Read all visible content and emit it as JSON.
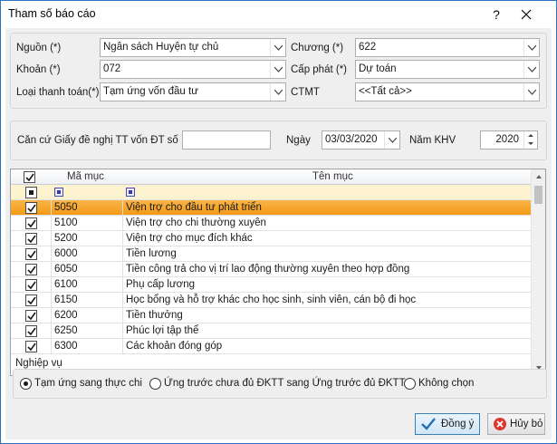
{
  "window": {
    "title": "Tham số báo cáo",
    "help_label": "?"
  },
  "params": {
    "nguon_label": "Nguồn (*)",
    "nguon_value": "Ngân sách Huyện tự chủ",
    "khoan_label": "Khoản (*)",
    "khoan_value": "072",
    "loai_tt_label": "Loại thanh toán(*)",
    "loai_tt_value": "Tạm ứng vốn đầu tư",
    "chuong_label": "Chương (*)",
    "chuong_value": "622",
    "cap_phat_label": "Cấp phát (*)",
    "cap_phat_value": "Dự toán",
    "ctmt_label": "CTMT",
    "ctmt_value": "<<Tất cả>>"
  },
  "doc": {
    "can_cu_label": "Căn cứ Giấy đề nghị TT vốn ĐT số",
    "can_cu_value": "",
    "ngay_label": "Ngày",
    "ngay_value": "03/03/2020",
    "nam_khv_label": "Năm KHV",
    "nam_khv_value": "2020"
  },
  "grid": {
    "headers": {
      "code": "Mã mục",
      "name": "Tên mục"
    },
    "rows": [
      {
        "code": "5050",
        "name": "Viện trợ cho đầu tư phát triển"
      },
      {
        "code": "5100",
        "name": "Viện trợ cho chi thường xuyên"
      },
      {
        "code": "5200",
        "name": "Viện trợ cho mục đích khác"
      },
      {
        "code": "6000",
        "name": "Tiền lương"
      },
      {
        "code": "6050",
        "name": "Tiền công trả cho vị trí lao động thường xuyên theo hợp đồng"
      },
      {
        "code": "6100",
        "name": "Phụ cấp lương"
      },
      {
        "code": "6150",
        "name": "Học bổng và hỗ trợ khác cho học sinh, sinh viên, cán bộ đi học"
      },
      {
        "code": "6200",
        "name": "Tiền thưởng"
      },
      {
        "code": "6250",
        "name": "Phúc lợi tập thể"
      },
      {
        "code": "6300",
        "name": "Các khoản đóng góp"
      }
    ]
  },
  "nghiep_vu": {
    "label": "Nghiệp vụ",
    "options": [
      "Tạm ứng sang thực chi",
      "Ứng trước chưa đủ ĐKTT sang Ứng trước đủ ĐKTT",
      "Không chọn"
    ],
    "selected_index": 0
  },
  "buttons": {
    "ok": "Đồng ý",
    "cancel": "Hủy bỏ"
  },
  "colors": {
    "selected_row": "#f39a14",
    "filter_row": "#fdf4cf",
    "window_border": "#2b73c4"
  }
}
